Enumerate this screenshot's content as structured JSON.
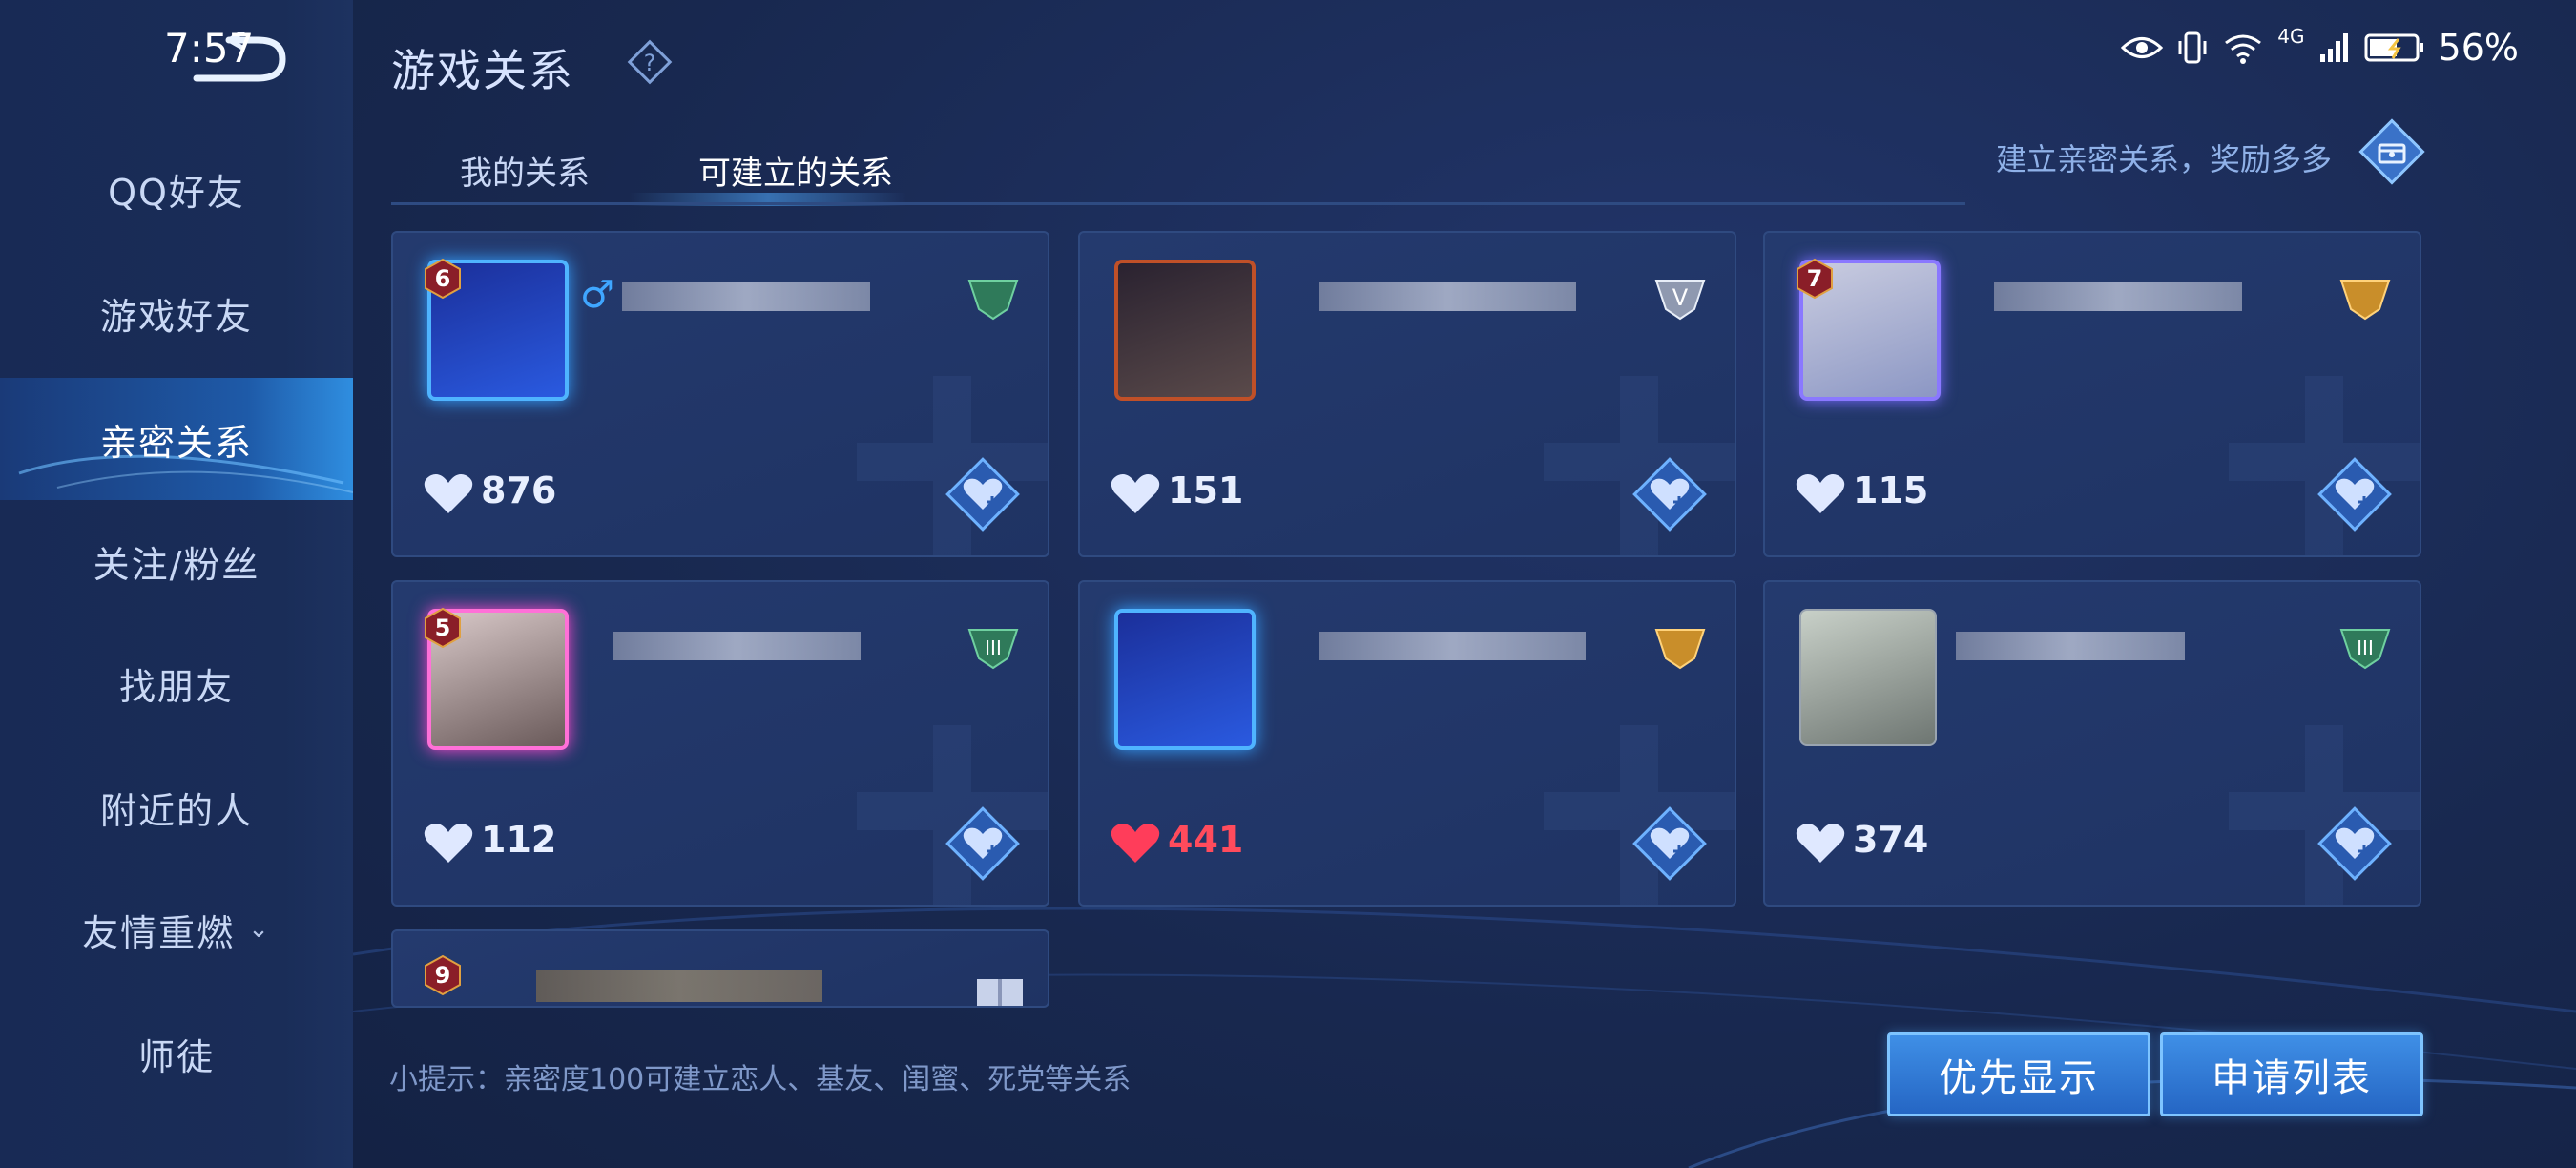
{
  "status_bar": {
    "time": "7:57",
    "battery": "56%",
    "network": "4G"
  },
  "page_title": "游戏关系",
  "sidebar": {
    "items": [
      {
        "label": "QQ好友",
        "active": false
      },
      {
        "label": "游戏好友",
        "active": false
      },
      {
        "label": "亲密关系",
        "active": true
      },
      {
        "label": "关注/粉丝",
        "active": false
      },
      {
        "label": "找朋友",
        "active": false
      },
      {
        "label": "附近的人",
        "active": false
      },
      {
        "label": "友情重燃",
        "active": false,
        "has_dropdown": true
      },
      {
        "label": "师徒",
        "active": false
      }
    ]
  },
  "tabs": [
    {
      "label": "我的关系",
      "active": false
    },
    {
      "label": "可建立的关系",
      "active": true
    }
  ],
  "reward_text": "建立亲密关系，奖励多多",
  "cards": [
    {
      "level": "6",
      "intimacy": "876",
      "gender": "♂",
      "rank": "gold-tri",
      "heart_color": "#dfe8ff"
    },
    {
      "level": "",
      "intimacy": "151",
      "gender": "",
      "rank": "silver-v",
      "heart_color": "#dfe8ff"
    },
    {
      "level": "7",
      "intimacy": "115",
      "gender": "",
      "rank": "gold",
      "heart_color": "#dfe8ff"
    },
    {
      "level": "5",
      "intimacy": "112",
      "gender": "",
      "rank": "green-iii",
      "heart_color": "#dfe8ff"
    },
    {
      "level": "",
      "intimacy": "441",
      "gender": "",
      "rank": "gold",
      "heart_color": "#ff3d5a"
    },
    {
      "level": "",
      "intimacy": "374",
      "gender": "",
      "rank": "green-iii",
      "heart_color": "#dfe8ff"
    }
  ],
  "partial_card": {
    "level": "9"
  },
  "hint": "小提示：亲密度100可建立恋人、基友、闺蜜、死党等关系",
  "buttons": {
    "priority": "优先显示",
    "requests": "申请列表"
  },
  "colors": {
    "accent": "#3f8fe6",
    "active_heart": "#ff3d5a",
    "sidebar_active": "#2f8ee0"
  }
}
